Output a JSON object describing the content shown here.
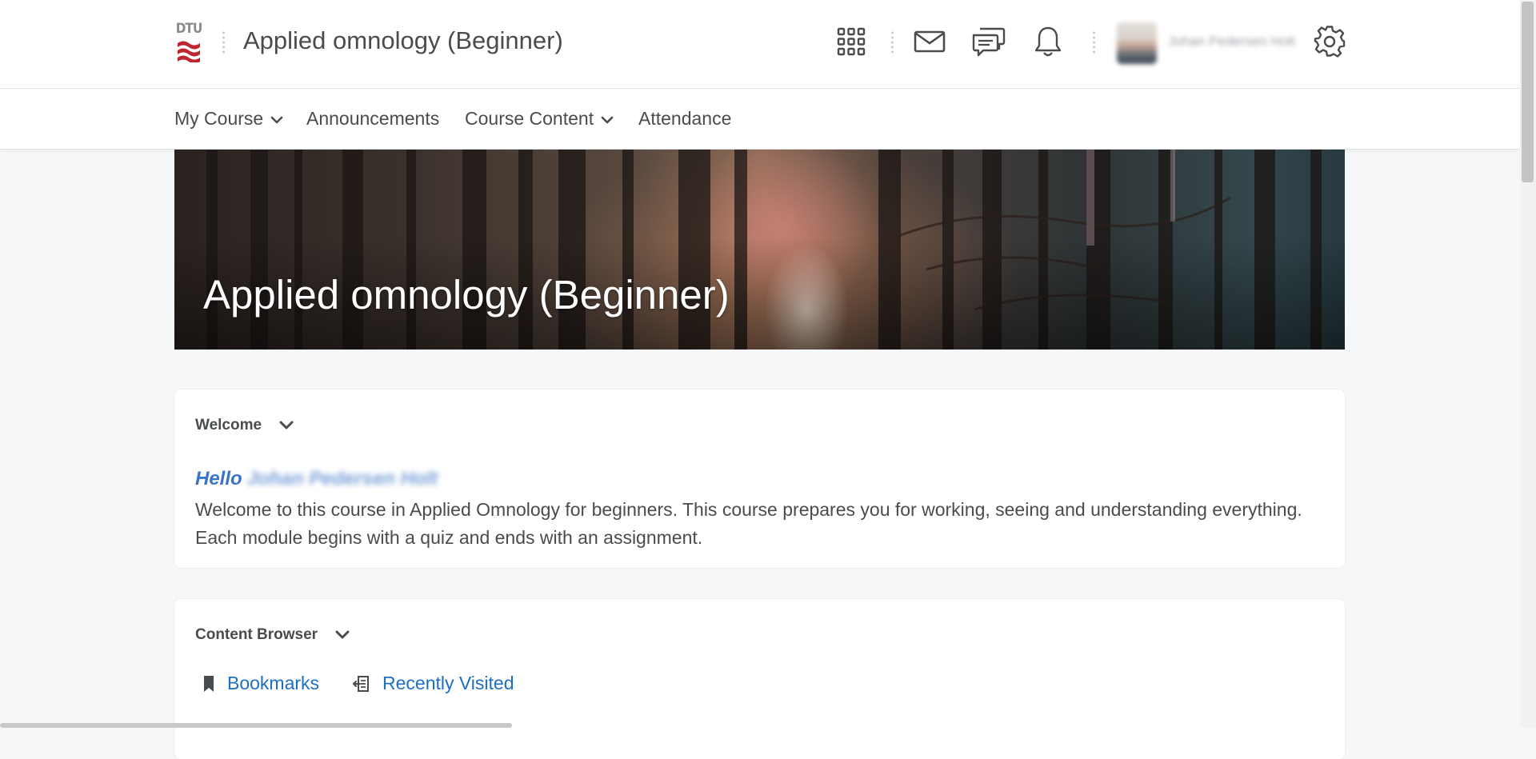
{
  "header": {
    "logo_text": "DTU",
    "course_title": "Applied omnology (Beginner)",
    "user_name": "Johan Pedersen Holt",
    "icons": [
      "apps-grid-icon",
      "mail-icon",
      "chat-icon",
      "bell-icon",
      "gear-icon"
    ]
  },
  "nav": {
    "my_course": "My Course",
    "announcements": "Announcements",
    "course_content": "Course Content",
    "attendance": "Attendance"
  },
  "banner": {
    "title": "Applied omnology (Beginner)"
  },
  "welcome": {
    "heading": "Welcome",
    "hello": "Hello",
    "user_name": "Johan Pedersen Holt",
    "text": "Welcome to this course in Applied Omnology for beginners. This course prepares you for working, seeing and understanding everything. Each module begins with a quiz and ends with an assignment."
  },
  "content_browser": {
    "heading": "Content Browser",
    "bookmarks": "Bookmarks",
    "recently_visited": "Recently Visited"
  },
  "colors": {
    "link": "#1e6ec1",
    "hello": "#3a74c4",
    "text": "#494c4e",
    "logo_red": "#c0262d",
    "page_bg": "#f6f7f8"
  }
}
